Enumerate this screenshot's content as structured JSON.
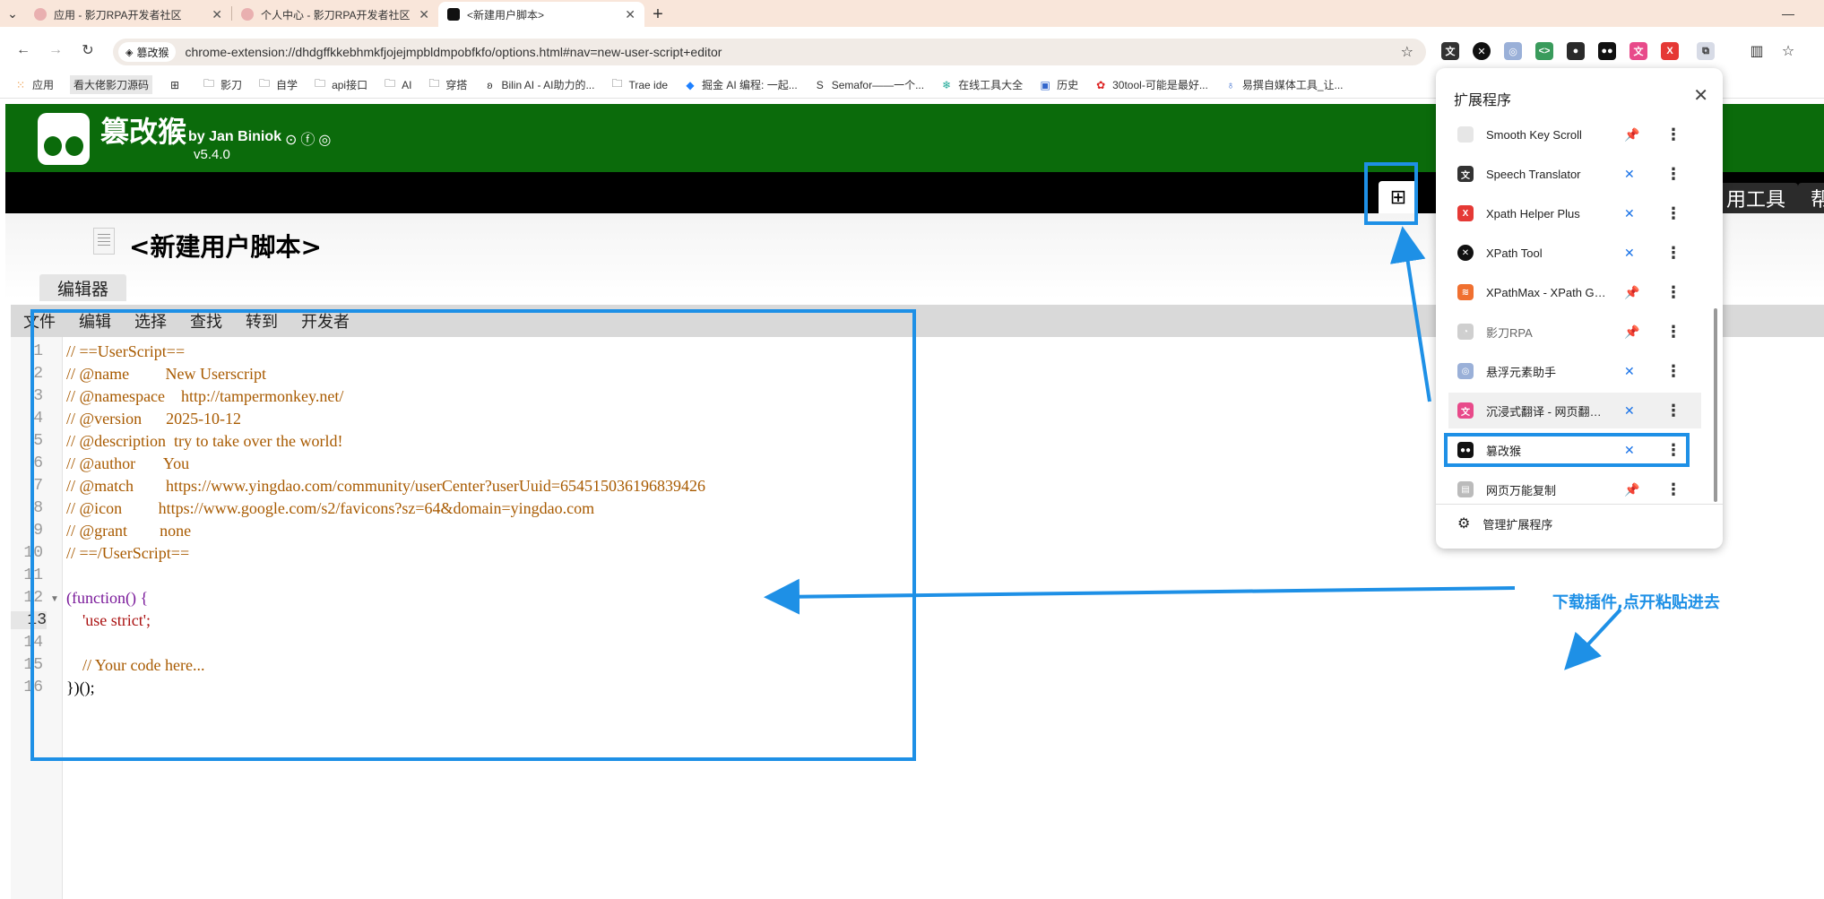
{
  "tabs": [
    {
      "title": "应用 - 影刀RPA开发者社区",
      "active": false
    },
    {
      "title": "个人中心 - 影刀RPA开发者社区",
      "active": false
    },
    {
      "title": "<新建用户脚本>",
      "active": true
    }
  ],
  "omnibox": {
    "chip": "篡改猴",
    "url": "chrome-extension://dhdgffkkebhmkfjojejmpbldmpobfkfo/options.html#nav=new-user-script+editor"
  },
  "bookmarks": [
    "应用",
    "看大佬影刀源码",
    "影刀",
    "自学",
    "api接口",
    "AI",
    "穿搭",
    "Bilin AI - AI助力的...",
    "Trae ide",
    "掘金 AI 编程: 一起...",
    "Semafor——一个...",
    "在线工具大全",
    "历史",
    "30tool-可能是最好...",
    "易撰自媒体工具_让..."
  ],
  "tampermonkey": {
    "name": "篡改猴",
    "author": "by Jan Biniok",
    "version": "v5.4.0",
    "tabs_right": [
      "用工具",
      "帮"
    ]
  },
  "script": {
    "title": "<新建用户脚本>",
    "editor_tab": "编辑器"
  },
  "menubar": [
    "文件",
    "编辑",
    "选择",
    "查找",
    "转到",
    "开发者"
  ],
  "code_lines": [
    "// ==UserScript==",
    "// @name         New Userscript",
    "// @namespace    http://tampermonkey.net/",
    "// @version      2025-10-12",
    "// @description  try to take over the world!",
    "// @author       You",
    "// @match        https://www.yingdao.com/community/userCenter?userUuid=654515036196839426",
    "// @icon         https://www.google.com/s2/favicons?sz=64&domain=yingdao.com",
    "// @grant        none",
    "// ==/UserScript==",
    "",
    "(function() {",
    "    'use strict';",
    "",
    "    // Your code here...",
    "})();"
  ],
  "line_numbers": [
    "1",
    "2",
    "3",
    "4",
    "5",
    "6",
    "7",
    "8",
    "9",
    "10",
    "11",
    "12",
    "13",
    "14",
    "15",
    "16"
  ],
  "extensions_panel": {
    "title": "扩展程序",
    "items": [
      {
        "name": "Smooth Key Scroll",
        "pinned": true,
        "icon": "scroll-icon",
        "color": "#dddddd"
      },
      {
        "name": "Speech Translator",
        "pinned": false,
        "icon": "translate-icon",
        "color": "#333333"
      },
      {
        "name": "Xpath Helper Plus",
        "pinned": false,
        "icon": "xpath-icon",
        "color": "#e53935"
      },
      {
        "name": "XPath Tool",
        "pinned": false,
        "icon": "xpath-tool-icon",
        "color": "#111111"
      },
      {
        "name": "XPathMax - XPath Ge...",
        "pinned": true,
        "icon": "xpathmax-icon",
        "color": "#f07030"
      },
      {
        "name": "影刀RPA",
        "pinned": true,
        "icon": "yingdao-icon",
        "color": "#bbbbbb"
      },
      {
        "name": "悬浮元素助手",
        "pinned": false,
        "icon": "float-element-icon",
        "color": "#7c9cc8"
      },
      {
        "name": "沉浸式翻译 - 网页翻译...",
        "pinned": false,
        "icon": "immersive-translate-icon",
        "color": "#e84a8a"
      },
      {
        "name": "篡改猴",
        "pinned": false,
        "icon": "tampermonkey-icon",
        "color": "#111111"
      },
      {
        "name": "网页万能复制",
        "pinned": true,
        "icon": "copy-icon",
        "color": "#aaaaaa"
      }
    ],
    "manage_label": "管理扩展程序"
  },
  "annotation": {
    "text": "下载插件,点开粘贴进去",
    "color": "#1e90e6"
  }
}
